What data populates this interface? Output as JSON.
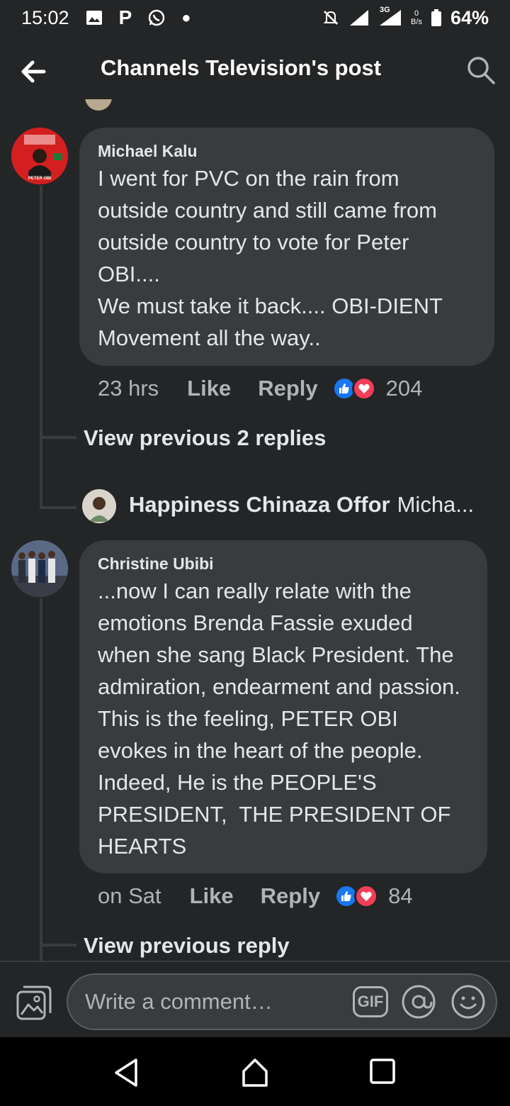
{
  "status_bar": {
    "time": "15:02",
    "carrier_letter": "P",
    "network": "3G",
    "data_speed_top": "0",
    "data_speed_unit": "B/s",
    "battery": "64%"
  },
  "header": {
    "title": "Channels Television's post"
  },
  "comments": [
    {
      "author": "Michael Kalu",
      "text": "I went for PVC on the rain from outside country and still came from outside country to vote for Peter OBI....\nWe must take it back.... OBI-DIENT Movement all the way..",
      "time": "23 hrs",
      "like_label": "Like",
      "reply_label": "Reply",
      "reaction_count": "204",
      "avatar_caption": "PETER OBI",
      "view_replies_label": "View previous 2 replies",
      "reply_preview": {
        "author": "Happiness Chinaza Offor",
        "snippet": "Micha..."
      }
    },
    {
      "author": "Christine Ubibi",
      "text": "...now I can really relate with the emotions Brenda Fassie exuded when she sang Black President. The admiration, endearment and passion. This is the feeling, PETER OBI evokes in the heart of the people. Indeed, He is the PEOPLE'S PRESIDENT,  THE PRESIDENT OF HEARTS",
      "time": "on Sat",
      "like_label": "Like",
      "reply_label": "Reply",
      "reaction_count": "84",
      "view_replies_label": "View previous reply"
    }
  ],
  "composer": {
    "placeholder": "Write a comment…",
    "gif_label": "GIF"
  },
  "colors": {
    "background": "#242526",
    "bubble": "#3a3b3c",
    "like_blue": "#1877f2",
    "love_red": "#f33e58"
  }
}
